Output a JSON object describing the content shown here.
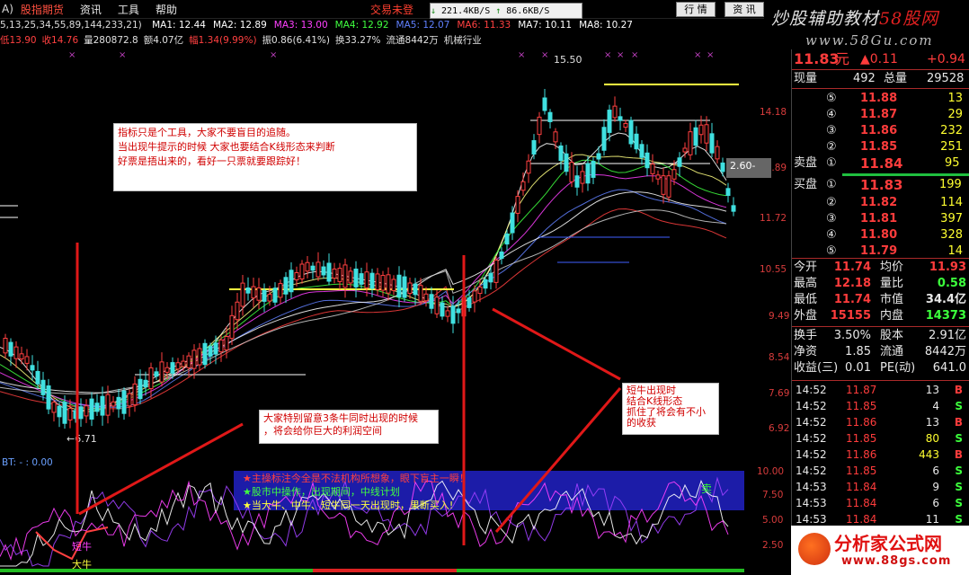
{
  "menu": {
    "lead": "A)",
    "brand": "股指期货",
    "items": [
      "资讯",
      "工具",
      "帮助"
    ],
    "title": "交易未登",
    "net_up": "221.4KB/S",
    "net_down": "86.6KB/S",
    "btn_quote": "行 情",
    "btn_info": "资 讯"
  },
  "banner": {
    "line1_white": "炒股辅助教材",
    "line1_red": "58股网",
    "line2": "www.58Gu.com"
  },
  "ma": {
    "params": "5,13,25,34,55,89,144,233,21)",
    "items": [
      {
        "label": "MA1: 12.44",
        "color": "#ffffff"
      },
      {
        "label": "MA2: 12.89",
        "color": "#ffffff"
      },
      {
        "label": "MA3: 13.00",
        "color": "#ff40ff"
      },
      {
        "label": "MA4: 12.92",
        "color": "#40ff40"
      },
      {
        "label": "MA5: 12.07",
        "color": "#6080ff"
      },
      {
        "label": "MA6: 11.33",
        "color": "#ff4040"
      },
      {
        "label": "MA7: 10.11",
        "color": "#ffffff"
      },
      {
        "label": "MA8: 10.27",
        "color": "#ffffff"
      }
    ]
  },
  "info": [
    {
      "label": "低13.90",
      "color": "#ff4040"
    },
    {
      "label": "收14.76",
      "color": "#ff4040"
    },
    {
      "label": "量280872.8",
      "color": "#e0e0e0"
    },
    {
      "label": "额4.07亿",
      "color": "#e0e0e0"
    },
    {
      "label": "幅1.34(9.99%)",
      "color": "#ff4040"
    },
    {
      "label": "振0.86(6.41%)",
      "color": "#e0e0e0"
    },
    {
      "label": "换33.27%",
      "color": "#e0e0e0"
    },
    {
      "label": "流通8442万",
      "color": "#e0e0e0"
    },
    {
      "label": "机械行业",
      "color": "#e0e0e0"
    }
  ],
  "chart": {
    "price_ticks": [
      "14.18",
      "12.89",
      "11.72",
      "10.55",
      "9.49",
      "8.54",
      "7.69",
      "6.92"
    ],
    "high_label": "15.50",
    "low_label": "←6.71",
    "mid_label": "2.60-",
    "indicator_label": "BT: - : 0.00",
    "indicator_ticks": [
      "10.00",
      "7.50",
      "5.00",
      "2.50"
    ],
    "tag_sell": "卖",
    "tag_calf": "短牛",
    "tag_bull": "大牛"
  },
  "notes": {
    "box1": [
      "指标只是个工具，大家不要盲目的追随。",
      "当出现牛提示的时候  大家也要结合K线形态来判断",
      "好票是捂出来的，看好一只票就要跟踪好！"
    ],
    "box2": [
      "大家特别留意3条牛同时出现的时候",
      "，将会给你巨大的利润空间"
    ],
    "box3": [
      "短牛出现时",
      "结合K线形态",
      "抓住了将会有不小",
      "的收获"
    ],
    "legend": [
      "★主操标注今全是不法机构所想象，眼下盲主一瞬！",
      "★股市中操作，出现期间，中线计划",
      "★当大牛、中牛、短牛同一天出现时，果断买入!"
    ]
  },
  "quote": {
    "price": "11.83",
    "unit": "元",
    "change": "▲0.11",
    "change_pct": "+0.94",
    "now_vol_label": "现量",
    "now_vol": "492",
    "total_vol_label": "总量",
    "total_vol": "29528",
    "asks": [
      {
        "lvl": "⑤",
        "price": "11.88",
        "vol": "13"
      },
      {
        "lvl": "④",
        "price": "11.87",
        "vol": "29"
      },
      {
        "lvl": "③",
        "price": "11.86",
        "vol": "232"
      },
      {
        "lvl": "②",
        "price": "11.85",
        "vol": "251"
      }
    ],
    "ask1_label": "卖盘",
    "ask1": {
      "lvl": "①",
      "price": "11.84",
      "vol": "95"
    },
    "bid1_label": "买盘",
    "bid1": {
      "lvl": "①",
      "price": "11.83",
      "vol": "199"
    },
    "bids": [
      {
        "lvl": "②",
        "price": "11.82",
        "vol": "114"
      },
      {
        "lvl": "③",
        "price": "11.81",
        "vol": "397"
      },
      {
        "lvl": "④",
        "price": "11.80",
        "vol": "328"
      },
      {
        "lvl": "⑤",
        "price": "11.79",
        "vol": "14"
      }
    ],
    "stats": [
      {
        "l1": "今开",
        "v1": "11.74",
        "c1": "red",
        "l2": "均价",
        "v2": "11.93",
        "c2": "red"
      },
      {
        "l1": "最高",
        "v1": "12.18",
        "c1": "red",
        "l2": "量比",
        "v2": "0.58",
        "c2": "green"
      },
      {
        "l1": "最低",
        "v1": "11.74",
        "c1": "red",
        "l2": "市值",
        "v2": "34.4亿",
        "c2": "white"
      },
      {
        "l1": "外盘",
        "v1": "15155",
        "c1": "red",
        "l2": "内盘",
        "v2": "14373",
        "c2": "green"
      }
    ],
    "stats2": [
      {
        "l1": "换手",
        "v1": "3.50%",
        "l2": "股本",
        "v2": "2.91亿"
      },
      {
        "l1": "净资",
        "v1": "1.85",
        "l2": "流通",
        "v2": "8442万"
      },
      {
        "l1": "收益(三)",
        "v1": "0.01",
        "l2": "PE(动)",
        "v2": "641.0"
      }
    ],
    "ticks": [
      {
        "t": "14:52",
        "p": "11.87",
        "v": "13",
        "f": "B",
        "vy": false
      },
      {
        "t": "14:52",
        "p": "11.85",
        "v": "4",
        "f": "S",
        "vy": false
      },
      {
        "t": "14:52",
        "p": "11.86",
        "v": "13",
        "f": "B",
        "vy": false
      },
      {
        "t": "14:52",
        "p": "11.85",
        "v": "80",
        "f": "S",
        "vy": true
      },
      {
        "t": "14:52",
        "p": "11.86",
        "v": "443",
        "f": "B",
        "vy": true
      },
      {
        "t": "14:52",
        "p": "11.85",
        "v": "6",
        "f": "S",
        "vy": false
      },
      {
        "t": "14:53",
        "p": "11.84",
        "v": "9",
        "f": "S",
        "vy": false
      },
      {
        "t": "14:53",
        "p": "11.84",
        "v": "6",
        "f": "S",
        "vy": false
      },
      {
        "t": "14:53",
        "p": "11.84",
        "v": "11",
        "f": "S",
        "vy": false
      }
    ]
  },
  "footer": {
    "name": "分析家公式网",
    "url": "www.88gs.com"
  }
}
